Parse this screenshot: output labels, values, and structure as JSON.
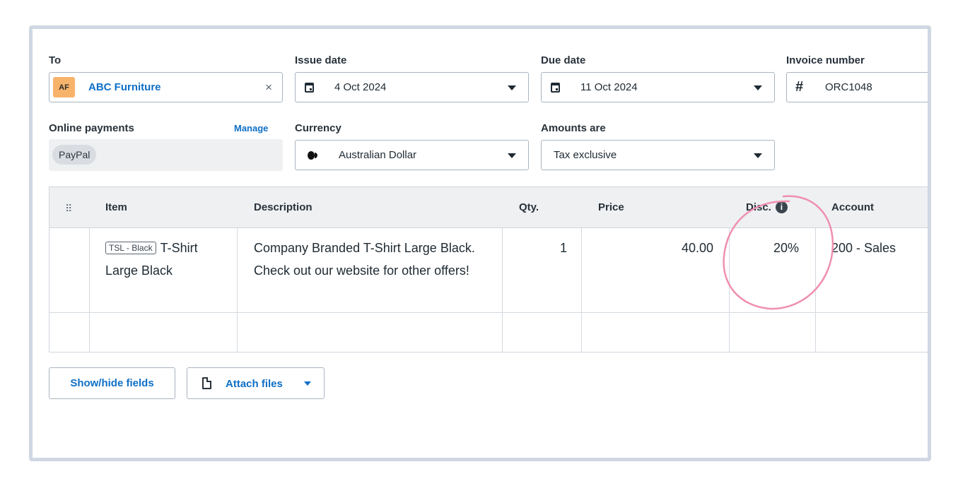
{
  "form": {
    "to_label": "To",
    "contact_initials": "AF",
    "contact_name": "ABC Furniture",
    "clear_symbol": "×",
    "issue_date_label": "Issue date",
    "issue_date": "4 Oct 2024",
    "due_date_label": "Due date",
    "due_date": "11 Oct 2024",
    "invoice_number_label": "Invoice number",
    "invoice_hash": "#",
    "invoice_number": "ORC1048",
    "online_payments_label": "Online payments",
    "manage_label": "Manage",
    "payment_method": "PayPal",
    "currency_label": "Currency",
    "currency": "Australian Dollar",
    "amounts_label": "Amounts are",
    "amounts": "Tax exclusive"
  },
  "table": {
    "headers": {
      "item": "Item",
      "description": "Description",
      "qty": "Qty.",
      "price": "Price",
      "disc": "Disc.",
      "account": "Account"
    },
    "info_symbol": "i",
    "rows": [
      {
        "item_code": "TSL - Black",
        "item_name": "T-Shirt Large Black",
        "description": "Company Branded T-Shirt Large Black.  Check out our website for other offers!",
        "qty": "1",
        "price": "40.00",
        "disc": "20%",
        "account": "200 - Sales"
      }
    ]
  },
  "buttons": {
    "show_hide": "Show/hide fields",
    "attach": "Attach files"
  },
  "icons": {
    "drag": "drag-handle-icon",
    "calendar": "calendar-icon",
    "info": "info-icon",
    "document": "document-icon"
  },
  "colors": {
    "accent": "#0f6fc6",
    "avatar": "#f8b36b",
    "annotation": "#ef8fae"
  }
}
